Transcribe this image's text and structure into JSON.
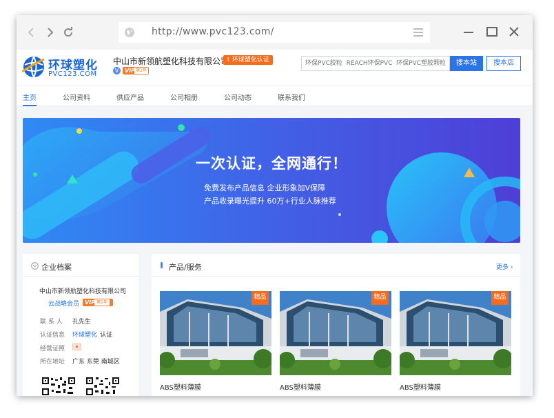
{
  "browser": {
    "url": "http://www.pvc123.com/"
  },
  "site": {
    "logo_cn": "环球塑化",
    "logo_en": "PVC123.COM",
    "company_name": "中山市新领航塑化科技有限公司",
    "cert_badge": "环球塑化认证",
    "vip_label": "VIP",
    "vip_year": "第2年",
    "search_placeholder": "环保PVC胶粒  REACH环保PVC  环保PVC塑胶颗粒",
    "search_site_label": "搜本站",
    "search_shop_label": "搜本店"
  },
  "nav": {
    "items": [
      "主页",
      "公司资料",
      "供应产品",
      "公司相册",
      "公司动态",
      "联系我们"
    ],
    "active_index": 0
  },
  "banner": {
    "title": "一次认证，全网通行！",
    "line1": "免费发布产品信息    企业形象加V保障",
    "line2": "产品收录曝光提升    60万+行业人脉推荐"
  },
  "profile": {
    "title": "企业档案",
    "company_name": "中山市新领航塑化科技有限公司",
    "member_label": "云战略会员",
    "vip_label": "VIP",
    "vip_year": "第2年",
    "rows": [
      {
        "label": "联 系 人",
        "value": "孔先生"
      },
      {
        "label": "认证信息",
        "value_link": "环球塑化",
        "value": "认证"
      },
      {
        "label": "经营证照",
        "value": ""
      },
      {
        "label": "所在地址",
        "value": "广东  东莞  南城区"
      }
    ]
  },
  "products": {
    "title": "产品/服务",
    "more_label": "更多",
    "items": [
      {
        "name": "ABS塑料薄膜",
        "tag": "精品"
      },
      {
        "name": "ABS塑料薄膜",
        "tag": "精品"
      },
      {
        "name": "ABS塑料薄膜",
        "tag": "精品"
      }
    ]
  },
  "colors": {
    "brand_blue": "#2b74e8",
    "accent_orange": "#f76b1c",
    "banner_start": "#2f83f4",
    "banner_end": "#4e3fd6"
  }
}
